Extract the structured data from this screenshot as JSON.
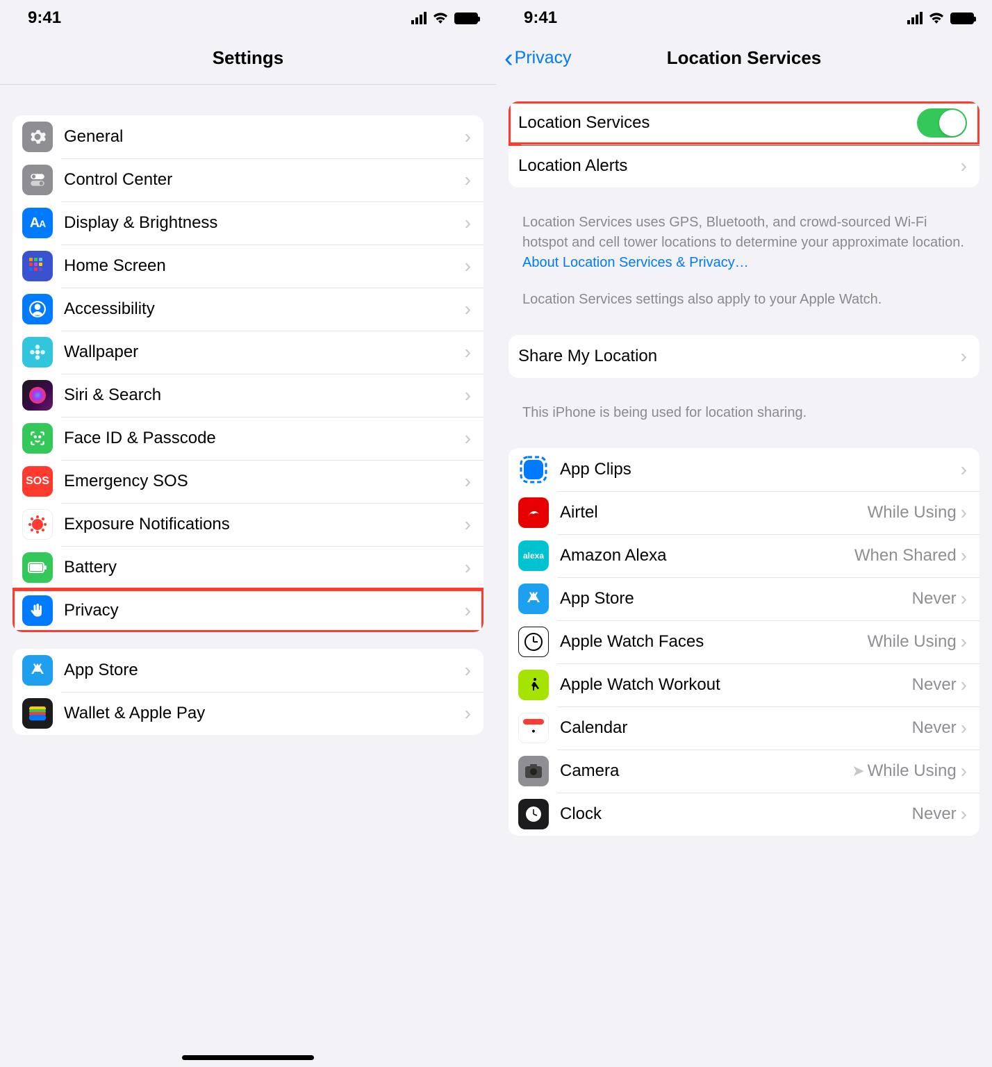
{
  "statusbar": {
    "time": "9:41"
  },
  "left": {
    "title": "Settings",
    "group1": [
      {
        "id": "general",
        "label": "General",
        "icon": "gear"
      },
      {
        "id": "control-center",
        "label": "Control Center",
        "icon": "toggles"
      },
      {
        "id": "display",
        "label": "Display & Brightness",
        "icon": "AA"
      },
      {
        "id": "home-screen",
        "label": "Home Screen",
        "icon": "grid"
      },
      {
        "id": "accessibility",
        "label": "Accessibility",
        "icon": "person"
      },
      {
        "id": "wallpaper",
        "label": "Wallpaper",
        "icon": "flower"
      },
      {
        "id": "siri",
        "label": "Siri & Search",
        "icon": "siri"
      },
      {
        "id": "faceid",
        "label": "Face ID & Passcode",
        "icon": "face"
      },
      {
        "id": "sos",
        "label": "Emergency SOS",
        "icon": "SOS"
      },
      {
        "id": "exposure",
        "label": "Exposure Notifications",
        "icon": "covid"
      },
      {
        "id": "battery",
        "label": "Battery",
        "icon": "battery"
      },
      {
        "id": "privacy",
        "label": "Privacy",
        "icon": "hand",
        "highlight": true
      }
    ],
    "group2": [
      {
        "id": "appstore",
        "label": "App Store",
        "icon": "appstore"
      },
      {
        "id": "wallet",
        "label": "Wallet & Apple Pay",
        "icon": "wallet"
      }
    ]
  },
  "right": {
    "back": "Privacy",
    "title": "Location Services",
    "toggle": {
      "label": "Location Services",
      "on": true,
      "highlight": true
    },
    "alerts": {
      "label": "Location Alerts"
    },
    "note1_a": "Location Services uses GPS, Bluetooth, and crowd-sourced Wi-Fi hotspot and cell tower locations to determine your approximate location. ",
    "note1_link": "About Location Services & Privacy…",
    "note2": "Location Services settings also apply to your Apple Watch.",
    "share": {
      "label": "Share My Location"
    },
    "share_note": "This iPhone is being used for location sharing.",
    "apps": [
      {
        "id": "appclips",
        "label": "App Clips",
        "status": "",
        "icon": "ai-appclips"
      },
      {
        "id": "airtel",
        "label": "Airtel",
        "status": "While Using",
        "icon": "ai-airtel"
      },
      {
        "id": "alexa",
        "label": "Amazon Alexa",
        "status": "When Shared",
        "icon": "ai-alexa"
      },
      {
        "id": "appstore",
        "label": "App Store",
        "status": "Never",
        "icon": "ai-appstore2"
      },
      {
        "id": "watchfaces",
        "label": "Apple Watch Faces",
        "status": "While Using",
        "icon": "ai-watchfaces"
      },
      {
        "id": "workout",
        "label": "Apple Watch Workout",
        "status": "Never",
        "icon": "ai-workout"
      },
      {
        "id": "calendar",
        "label": "Calendar",
        "status": "Never",
        "icon": "ai-calendar"
      },
      {
        "id": "camera",
        "label": "Camera",
        "status": "While Using",
        "icon": "ai-camera",
        "arrow": true
      },
      {
        "id": "clock",
        "label": "Clock",
        "status": "Never",
        "icon": "ai-clock"
      }
    ]
  }
}
